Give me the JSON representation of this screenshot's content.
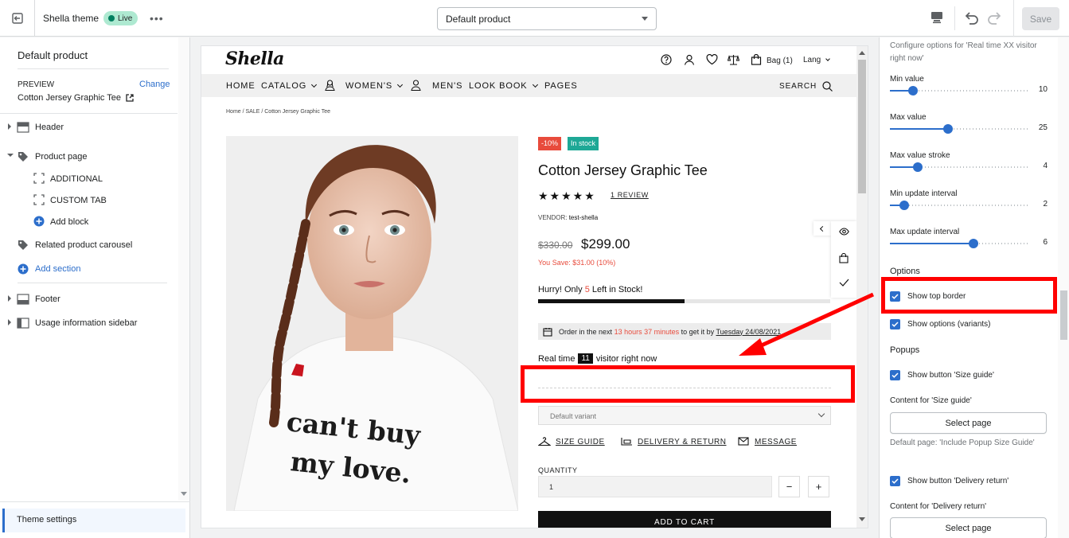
{
  "topbar": {
    "theme_name": "Shella theme",
    "live_label": "Live",
    "template_select": "Default product",
    "save_label": "Save"
  },
  "left": {
    "title": "Default product",
    "preview_label": "PREVIEW",
    "change_label": "Change",
    "preview_product": "Cotton Jersey Graphic Tee",
    "items": [
      {
        "label": "Header"
      },
      {
        "label": "Product page"
      },
      {
        "label": "ADDITIONAL"
      },
      {
        "label": "CUSTOM TAB"
      },
      {
        "label": "Add block"
      },
      {
        "label": "Related product carousel"
      },
      {
        "label": "Add section"
      },
      {
        "label": "Footer"
      },
      {
        "label": "Usage information sidebar"
      }
    ],
    "theme_settings": "Theme settings"
  },
  "store": {
    "logo": "Shella",
    "bag_label": "Bag (1)",
    "lang_label": "Lang",
    "nav": [
      "HOME",
      "CATALOG",
      "WOMEN'S",
      "MEN'S",
      "LOOK BOOK",
      "PAGES"
    ],
    "search_label": "SEARCH",
    "breadcrumb": "Home  /  SALE  /  Cotton Jersey Graphic Tee",
    "shirt_text_1": "can't buy",
    "shirt_text_2": "my love.",
    "product": {
      "badge_sale": "-10%",
      "badge_stock": "In stock",
      "title": "Cotton Jersey Graphic Tee",
      "stars": "★★★★★",
      "rating": 5,
      "review_link": "1 REVIEW",
      "vendor_label": "VENDOR:",
      "vendor": "test-shella",
      "old_price": "$330.00",
      "new_price": "$299.00",
      "you_save": "You Save: $31.00 (10%)",
      "hurry_prefix": "Hurry! Only ",
      "hurry_count": "5",
      "hurry_suffix": " Left in Stock!",
      "stock_level": 0.5,
      "order_prefix": "Order in the next",
      "order_time": "13 hours 37 minutes",
      "order_mid": "to get it by",
      "order_date": "Tuesday 24/08/2021",
      "visitors_prefix": "Real time",
      "visitors_count": "11",
      "visitors_suffix": "visitor right now",
      "variant": "Default variant",
      "size_guide": "SIZE GUIDE",
      "delivery_return": "DELIVERY & RETURN",
      "message": "MESSAGE",
      "quantity_label": "QUANTITY",
      "quantity_value": "1",
      "minus": "−",
      "plus": "+",
      "add_to_cart": "ADD TO CART"
    }
  },
  "settings": {
    "intro": "Configure options for 'Real time XX visitor right now'",
    "sliders": [
      {
        "label": "Min value",
        "value": 10,
        "min": 0,
        "max": 60
      },
      {
        "label": "Max value",
        "value": 25,
        "min": 0,
        "max": 60
      },
      {
        "label": "Max value stroke",
        "value": 4,
        "min": 0,
        "max": 20
      },
      {
        "label": "Min update interval",
        "value": 2,
        "min": 0,
        "max": 20
      },
      {
        "label": "Max update interval",
        "value": 6,
        "min": 0,
        "max": 10
      }
    ],
    "options_heading": "Options",
    "show_top_border": "Show top border",
    "show_options_variants": "Show options (variants)",
    "popups_heading": "Popups",
    "show_size_guide": "Show button 'Size guide'",
    "content_size_guide": "Content for 'Size guide'",
    "select_page": "Select page",
    "default_page_help": "Default page: 'Include Popup Size Guide'",
    "show_delivery_return": "Show button 'Delivery return'",
    "content_delivery_return": "Content for 'Delivery return'",
    "select_page_2": "Select page"
  },
  "colors": {
    "accent": "#2c6ecb",
    "annotation": "#ff0000",
    "sale_badge": "#e84b3c",
    "stock_badge": "#1ea896"
  }
}
